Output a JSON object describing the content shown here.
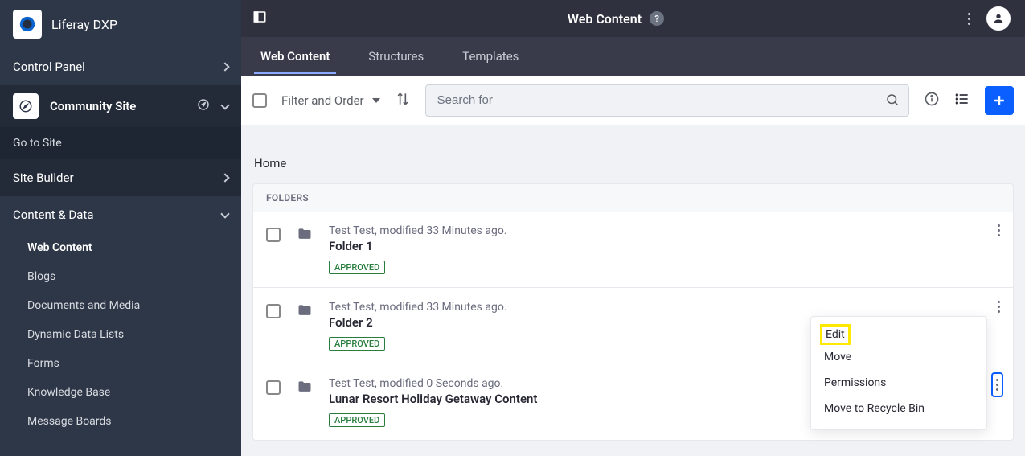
{
  "brand": {
    "title": "Liferay DXP"
  },
  "sidebar": {
    "control_panel": "Control Panel",
    "site_name": "Community Site",
    "go_to_site": "Go to Site",
    "site_builder": "Site Builder",
    "content_data": "Content & Data",
    "items": [
      {
        "label": "Web Content",
        "active": true
      },
      {
        "label": "Blogs"
      },
      {
        "label": "Documents and Media"
      },
      {
        "label": "Dynamic Data Lists"
      },
      {
        "label": "Forms"
      },
      {
        "label": "Knowledge Base"
      },
      {
        "label": "Message Boards"
      }
    ]
  },
  "header": {
    "title": "Web Content",
    "help": "?"
  },
  "tabs": [
    {
      "label": "Web Content",
      "active": true
    },
    {
      "label": "Structures"
    },
    {
      "label": "Templates"
    }
  ],
  "toolbar": {
    "filter_label": "Filter and Order",
    "search_placeholder": "Search for"
  },
  "breadcrumb": "Home",
  "folders_header": "FOLDERS",
  "rows": [
    {
      "meta": "Test Test, modified 33 Minutes ago.",
      "title": "Folder 1",
      "status": "APPROVED"
    },
    {
      "meta": "Test Test, modified 33 Minutes ago.",
      "title": "Folder 2",
      "status": "APPROVED"
    },
    {
      "meta": "Test Test, modified 0 Seconds ago.",
      "title": "Lunar Resort Holiday Getaway Content",
      "status": "APPROVED"
    }
  ],
  "context_menu": {
    "edit": "Edit",
    "move": "Move",
    "permissions": "Permissions",
    "recycle": "Move to Recycle Bin"
  }
}
